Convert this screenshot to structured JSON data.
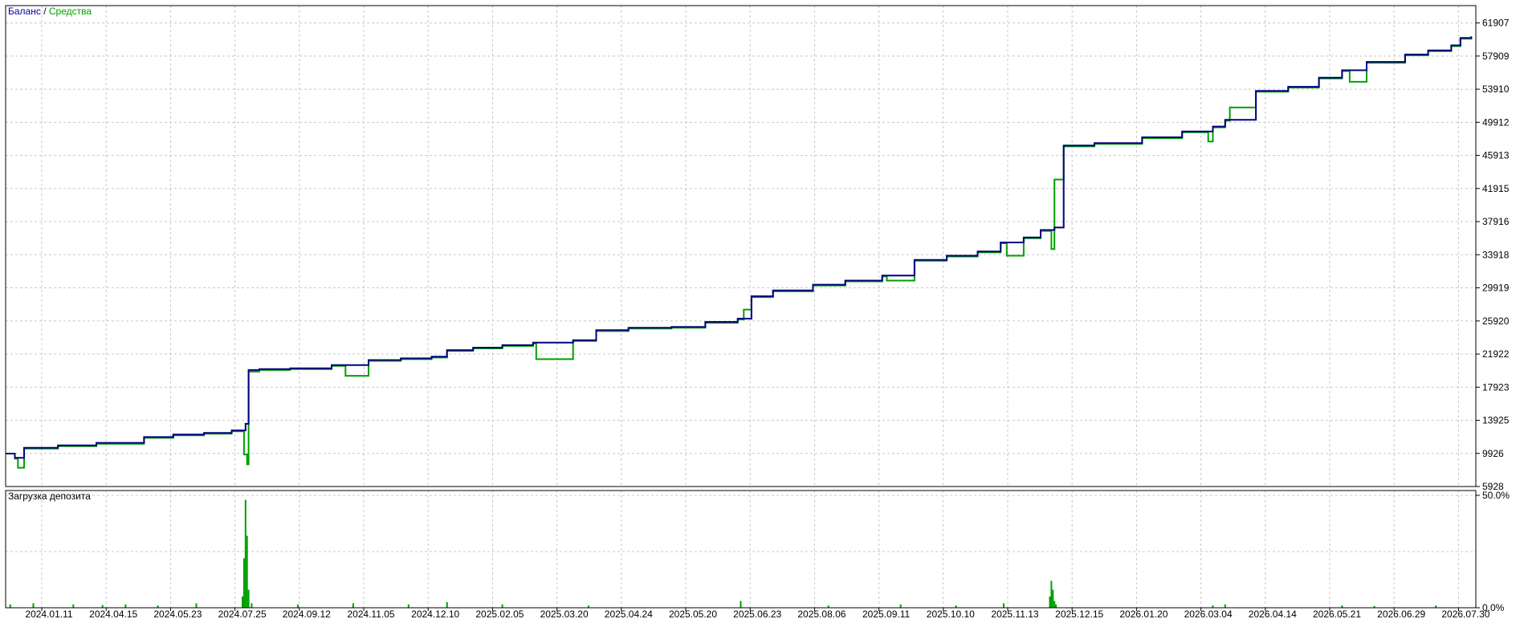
{
  "legend": {
    "balance_label": "Баланс",
    "separator": " / ",
    "equity_label": "Средства"
  },
  "deposit_panel": {
    "title": "Загрузка депозита",
    "ytick_labels": [
      "50.0%",
      "0.0%"
    ],
    "ylim": [
      0,
      50
    ]
  },
  "colors": {
    "balance": "#00007f",
    "equity": "#00a000",
    "grid": "#c8c8c8",
    "axis": "#000000",
    "legend_balance": "#0000aa",
    "legend_equity": "#00a000"
  },
  "chart_data": [
    {
      "type": "line",
      "ylim": [
        5928,
        64000
      ],
      "yticks": [
        5928,
        9926,
        13925,
        17923,
        21922,
        25920,
        29919,
        33918,
        37916,
        41915,
        45913,
        49912,
        53910,
        57909,
        61907
      ],
      "xlim": [
        "2024-01-02",
        "2026-08-15"
      ],
      "x_tick_labels": [
        "2024.01.11",
        "2024.04.15",
        "2024.05.23",
        "2024.07.25",
        "2024.09.12",
        "2024.11.05",
        "2024.12.10",
        "2025.02.05",
        "2025.03.20",
        "2025.04.24",
        "2025.05.20",
        "2025.06.23",
        "2025.08.06",
        "2025.09.11",
        "2025.10.10",
        "2025.11.13",
        "2025.12.15",
        "2026.01.20",
        "2026.03.04",
        "2026.04.14",
        "2026.05.21",
        "2026.06.29",
        "2026.07.30"
      ],
      "series": [
        {
          "name": "Баланс",
          "x": [
            "2024-01-02",
            "2024-01-08",
            "2024-01-14",
            "2024-02-05",
            "2024-03-01",
            "2024-04-01",
            "2024-04-20",
            "2024-05-10",
            "2024-05-28",
            "2024-06-06",
            "2024-06-08",
            "2024-06-15",
            "2024-07-05",
            "2024-08-01",
            "2024-08-25",
            "2024-09-15",
            "2024-10-05",
            "2024-10-15",
            "2024-11-01",
            "2024-11-20",
            "2024-12-10",
            "2025-01-05",
            "2025-01-20",
            "2025-02-10",
            "2025-03-10",
            "2025-04-01",
            "2025-04-22",
            "2025-05-01",
            "2025-05-15",
            "2025-06-10",
            "2025-07-01",
            "2025-07-25",
            "2025-08-15",
            "2025-09-05",
            "2025-09-25",
            "2025-10-10",
            "2025-10-25",
            "2025-11-05",
            "2025-11-14",
            "2025-11-20",
            "2025-12-10",
            "2026-01-10",
            "2026-02-05",
            "2026-02-25",
            "2026-03-05",
            "2026-03-25",
            "2026-04-15",
            "2026-05-05",
            "2026-05-20",
            "2026-06-05",
            "2026-06-30",
            "2026-07-15",
            "2026-07-30",
            "2026-08-05",
            "2026-08-12"
          ],
          "values": [
            9900,
            9400,
            10600,
            10900,
            11200,
            11900,
            12200,
            12400,
            12700,
            13500,
            20000,
            20100,
            20200,
            20600,
            21200,
            21400,
            21600,
            22400,
            22700,
            23000,
            23300,
            23600,
            24800,
            25100,
            25200,
            25800,
            26200,
            28900,
            29600,
            30300,
            30800,
            31400,
            33300,
            33800,
            34300,
            35400,
            36000,
            36900,
            37200,
            47100,
            47400,
            48100,
            48800,
            49400,
            50200,
            53700,
            54200,
            55300,
            56200,
            57200,
            58100,
            58600,
            59200,
            60100,
            60300
          ]
        },
        {
          "name": "Средства",
          "x": [
            "2024-01-02",
            "2024-01-08",
            "2024-01-10",
            "2024-01-14",
            "2024-02-05",
            "2024-03-01",
            "2024-04-01",
            "2024-04-20",
            "2024-05-10",
            "2024-05-28",
            "2024-06-05",
            "2024-06-07",
            "2024-06-08",
            "2024-06-15",
            "2024-07-05",
            "2024-08-01",
            "2024-08-10",
            "2024-08-25",
            "2024-09-15",
            "2024-10-05",
            "2024-10-15",
            "2024-11-01",
            "2024-11-20",
            "2024-12-10",
            "2024-12-12",
            "2025-01-05",
            "2025-01-20",
            "2025-02-10",
            "2025-03-10",
            "2025-04-01",
            "2025-04-22",
            "2025-04-26",
            "2025-05-01",
            "2025-05-15",
            "2025-06-10",
            "2025-07-01",
            "2025-07-25",
            "2025-07-28",
            "2025-08-15",
            "2025-09-05",
            "2025-09-25",
            "2025-10-10",
            "2025-10-14",
            "2025-10-25",
            "2025-11-05",
            "2025-11-12",
            "2025-11-14",
            "2025-11-20",
            "2025-12-10",
            "2026-01-10",
            "2026-02-05",
            "2026-02-22",
            "2026-02-25",
            "2026-03-05",
            "2026-03-08",
            "2026-03-25",
            "2026-04-15",
            "2026-05-05",
            "2026-05-20",
            "2026-05-25",
            "2026-06-05",
            "2026-06-30",
            "2026-07-15",
            "2026-07-30",
            "2026-08-05",
            "2026-08-12"
          ],
          "values": [
            9900,
            9300,
            8200,
            10500,
            10800,
            11100,
            11800,
            12100,
            12300,
            12600,
            9800,
            8600,
            19800,
            20000,
            20100,
            20500,
            19300,
            21100,
            21300,
            21500,
            22300,
            22600,
            22900,
            23200,
            21300,
            23500,
            24700,
            25000,
            25100,
            25700,
            26100,
            27300,
            28800,
            29500,
            30200,
            30700,
            31300,
            30800,
            33200,
            33700,
            34200,
            35300,
            33800,
            35900,
            36800,
            34600,
            43000,
            47000,
            47300,
            48000,
            48700,
            47600,
            49300,
            50100,
            51700,
            53600,
            54100,
            55200,
            56100,
            54800,
            57100,
            58000,
            58500,
            59100,
            60000,
            60200
          ]
        }
      ]
    },
    {
      "type": "bar",
      "ylim": [
        0,
        50
      ],
      "x": [
        "2024-01-05",
        "2024-01-20",
        "2024-02-15",
        "2024-03-05",
        "2024-03-20",
        "2024-04-10",
        "2024-05-05",
        "2024-06-04",
        "2024-06-05",
        "2024-06-06",
        "2024-06-07",
        "2024-06-08",
        "2024-06-10",
        "2024-07-10",
        "2024-08-15",
        "2024-09-20",
        "2024-10-15",
        "2024-11-20",
        "2025-01-15",
        "2025-04-24",
        "2025-06-20",
        "2025-08-06",
        "2025-09-11",
        "2025-10-12",
        "2025-11-11",
        "2025-11-12",
        "2025-11-13",
        "2025-11-14",
        "2025-11-15",
        "2026-02-25",
        "2026-03-05",
        "2026-05-20",
        "2026-06-10",
        "2026-07-20"
      ],
      "values": [
        1.5,
        2.0,
        1.5,
        1.2,
        1.5,
        1.0,
        2.0,
        5.0,
        22.0,
        48.0,
        32.0,
        8.0,
        2.0,
        1.5,
        2.0,
        1.5,
        2.5,
        1.5,
        1.0,
        3.0,
        1.0,
        1.5,
        1.0,
        2.0,
        5.0,
        12.0,
        8.0,
        3.0,
        1.5,
        1.0,
        1.5,
        1.0,
        0.8,
        1.0
      ]
    }
  ]
}
